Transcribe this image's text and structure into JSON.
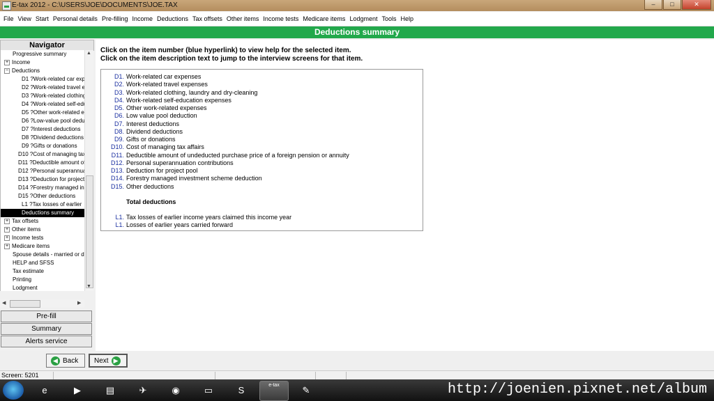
{
  "window": {
    "title": "E-tax 2012 - C:\\USERS\\JOE\\DOCUMENTS\\JOE.TAX",
    "minimize": "–",
    "maximize": "□",
    "close": "✕"
  },
  "menu": [
    "File",
    "View",
    "Start",
    "Personal details",
    "Pre-filling",
    "Income",
    "Deductions",
    "Tax offsets",
    "Other items",
    "Income tests",
    "Medicare items",
    "Lodgment",
    "Tools",
    "Help"
  ],
  "header": {
    "title": "Deductions summary"
  },
  "navigator": {
    "title": "Navigator",
    "items": [
      {
        "label": "Progressive summary",
        "level": 0,
        "expander": ""
      },
      {
        "label": "Income",
        "level": 1,
        "expander": "+"
      },
      {
        "label": "Deductions",
        "level": 1,
        "expander": "−"
      },
      {
        "label": "D1 ?Work-related car exp",
        "level": 2
      },
      {
        "label": "D2 ?Work-related travel e",
        "level": 2
      },
      {
        "label": "D3 ?Work-related clothing",
        "level": 2
      },
      {
        "label": "D4 ?Work-related self-edu",
        "level": 2
      },
      {
        "label": "D5 ?Other work-related e",
        "level": 2
      },
      {
        "label": "D6 ?Low-value pool dedu",
        "level": 2
      },
      {
        "label": "D7 ?Interest deductions",
        "level": 2
      },
      {
        "label": "D8 ?Dividend deductions",
        "level": 2
      },
      {
        "label": "D9 ?Gifts or donations",
        "level": 2
      },
      {
        "label": "D10 ?Cost of managing tax",
        "level": 3
      },
      {
        "label": "D11 ?Deductible amount of",
        "level": 3
      },
      {
        "label": "D12 ?Personal superannua",
        "level": 3
      },
      {
        "label": "D13 ?Deduction for project",
        "level": 3
      },
      {
        "label": "D14 ?Forestry managed in",
        "level": 3
      },
      {
        "label": "D15 ?Other deductions",
        "level": 3
      },
      {
        "label": "L1 ?Tax losses of earlier",
        "level": 2
      },
      {
        "label": "Deductions summary",
        "level": 2,
        "selected": true
      },
      {
        "label": "Tax offsets",
        "level": 1,
        "expander": "+"
      },
      {
        "label": "Other items",
        "level": 1,
        "expander": "+"
      },
      {
        "label": "Income tests",
        "level": 1,
        "expander": "+"
      },
      {
        "label": "Medicare items",
        "level": 1,
        "expander": "+"
      },
      {
        "label": "Spouse details - married or d",
        "level": 0,
        "expander": ""
      },
      {
        "label": "HELP and SFSS",
        "level": 0,
        "expander": ""
      },
      {
        "label": "Tax estimate",
        "level": 0,
        "expander": ""
      },
      {
        "label": "Printing",
        "level": 0,
        "expander": ""
      },
      {
        "label": "Lodgment",
        "level": 0,
        "expander": ""
      }
    ],
    "buttons": {
      "prefill": "Pre-fill",
      "summary": "Summary",
      "alerts": "Alerts service"
    }
  },
  "instructions": {
    "line1": "Click on the item number (blue hyperlink) to view help for the selected item.",
    "line2": "Click on the item description text to jump to the interview screens for that item."
  },
  "deductions": [
    {
      "code": "D1.",
      "desc": "Work-related car expenses"
    },
    {
      "code": "D2.",
      "desc": "Work-related travel expenses"
    },
    {
      "code": "D3.",
      "desc": "Work-related clothing, laundry and dry-cleaning"
    },
    {
      "code": "D4.",
      "desc": "Work-related self-education expenses"
    },
    {
      "code": "D5.",
      "desc": "Other work-related expenses"
    },
    {
      "code": "D6.",
      "desc": "Low value pool deduction"
    },
    {
      "code": "D7.",
      "desc": "Interest deductions"
    },
    {
      "code": "D8.",
      "desc": "Dividend deductions"
    },
    {
      "code": "D9.",
      "desc": "Gifts or donations"
    },
    {
      "code": "D10.",
      "desc": "Cost of managing tax affairs"
    },
    {
      "code": "D11.",
      "desc": "Deductible amount of undeducted purchase price of a foreign pension or annuity"
    },
    {
      "code": "D12.",
      "desc": "Personal superannuation contributions"
    },
    {
      "code": "D13.",
      "desc": "Deduction for project pool"
    },
    {
      "code": "D14.",
      "desc": "Forestry managed investment scheme deduction"
    },
    {
      "code": "D15.",
      "desc": "Other deductions"
    }
  ],
  "total_label": "Total deductions",
  "losses": [
    {
      "code": "L1.",
      "desc": "Tax losses of earlier income years claimed this income year"
    },
    {
      "code": "L1.",
      "desc": "Losses of earlier years carried forward"
    }
  ],
  "nav_buttons": {
    "back": "Back",
    "next": "Next"
  },
  "status": {
    "screen": "Screen: 5201"
  },
  "taskbar": {
    "items": [
      "internet-explorer-icon",
      "media-player-icon",
      "file-explorer-icon",
      "app-icon",
      "chrome-icon",
      "folder-icon",
      "skype-icon",
      "etax-icon",
      "paint-icon"
    ],
    "etax_label": "e-tax"
  },
  "watermark": "http://joenien.pixnet.net/album"
}
